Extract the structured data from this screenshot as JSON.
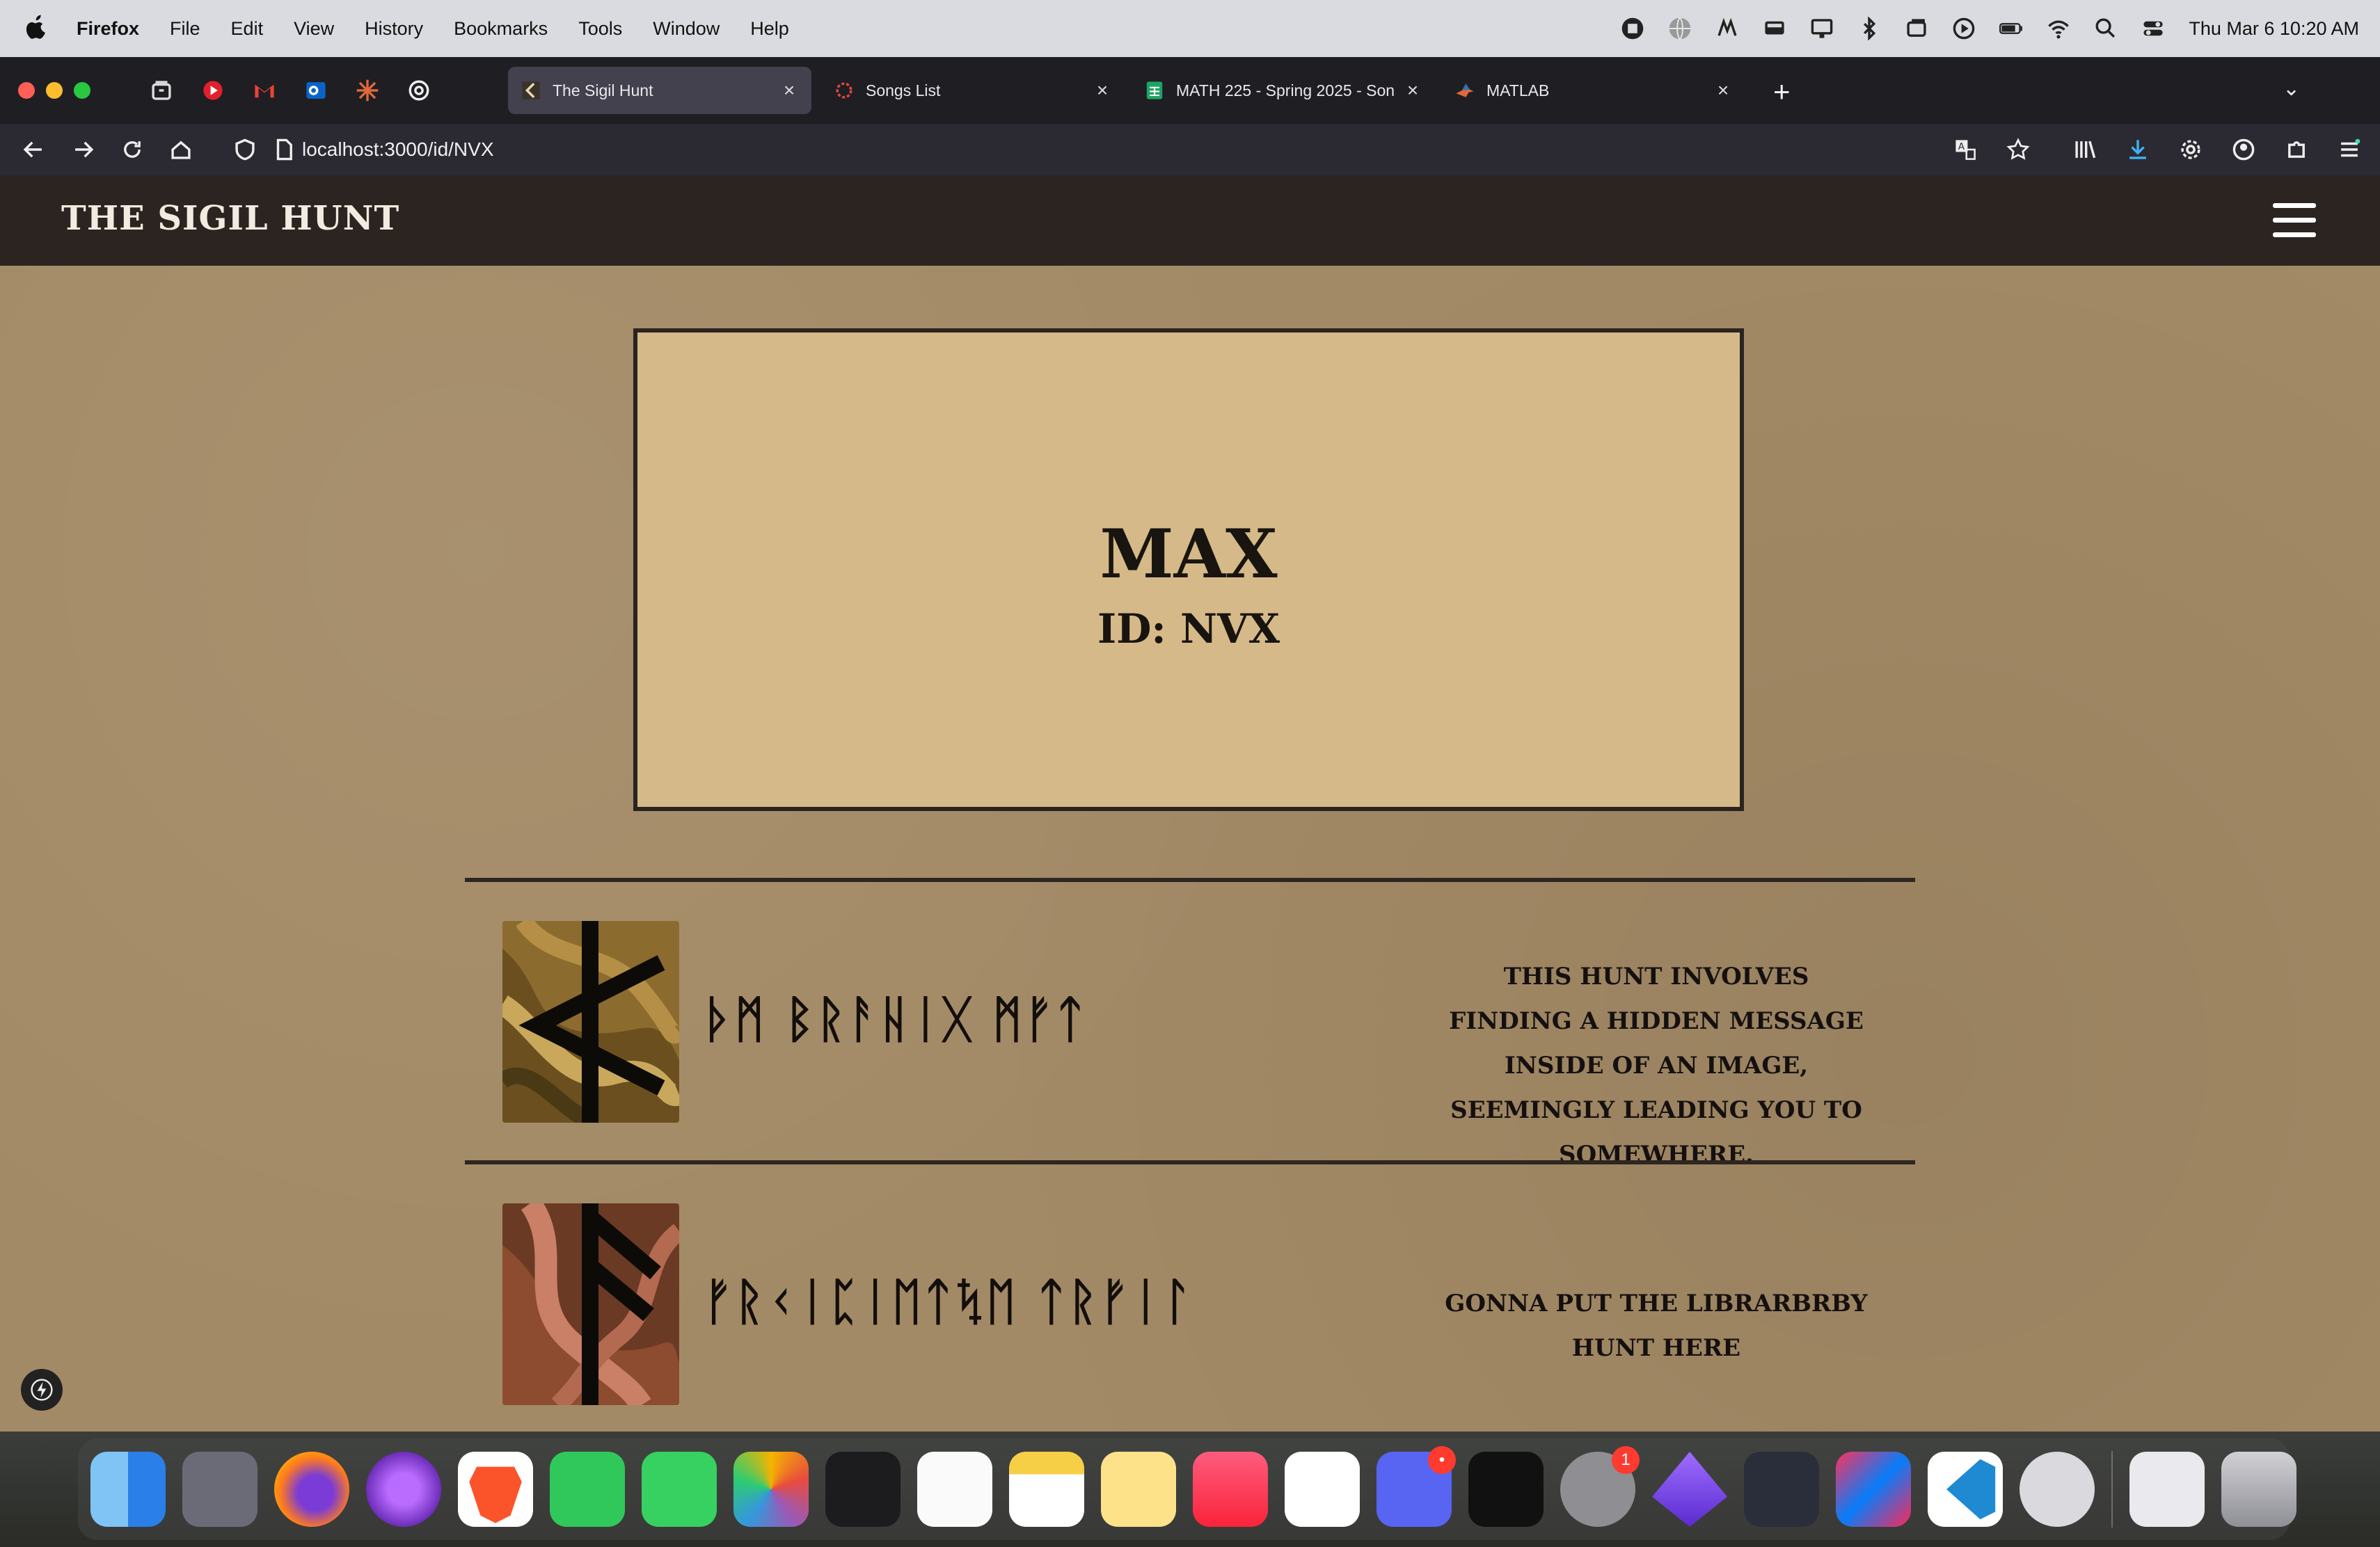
{
  "menubar": {
    "app_name": "Firefox",
    "items": [
      "File",
      "Edit",
      "View",
      "History",
      "Bookmarks",
      "Tools",
      "Window",
      "Help"
    ],
    "clock": "Thu Mar 6  10:20 AM"
  },
  "browser": {
    "tabs": [
      {
        "title": "The Sigil Hunt",
        "icon": "sigil-favicon-icon",
        "active": true
      },
      {
        "title": "Songs List",
        "icon": "songs-favicon-icon",
        "active": false
      },
      {
        "title": "MATH 225 - Spring 2025 - Son",
        "icon": "sheets-favicon-icon",
        "active": false
      },
      {
        "title": "MATLAB",
        "icon": "matlab-favicon-icon",
        "active": false
      }
    ],
    "url": "localhost:3000/id/NVX"
  },
  "site": {
    "title": "THE SIGIL HUNT",
    "profile": {
      "name": "MAX",
      "id_label": "ID: NVX"
    },
    "hunts": [
      {
        "title": "ᚦᛗ ᛒᚱᚨᚺᛁᚷ ᛗᚠᛏ",
        "description": "THIS HUNT INVOLVES FINDING A HIDDEN MESSAGE INSIDE OF AN IMAGE, SEEMINGLY LEADING YOU TO SOMEWHERE.",
        "icon": "kaun-rune-icon"
      },
      {
        "title": "ᚠᚱᚲᛁᛈᛁᛖᛏᛪᛖ ᛏᚱᚠᛁᛚ",
        "description": "GONNA PUT THE LIBRARBRBY HUNT HERE",
        "icon": "ansuz-rune-icon"
      }
    ]
  },
  "colors": {
    "page_bg": "#a38a66",
    "header_bg": "#2c2420",
    "card_bg": "#d6b988"
  }
}
